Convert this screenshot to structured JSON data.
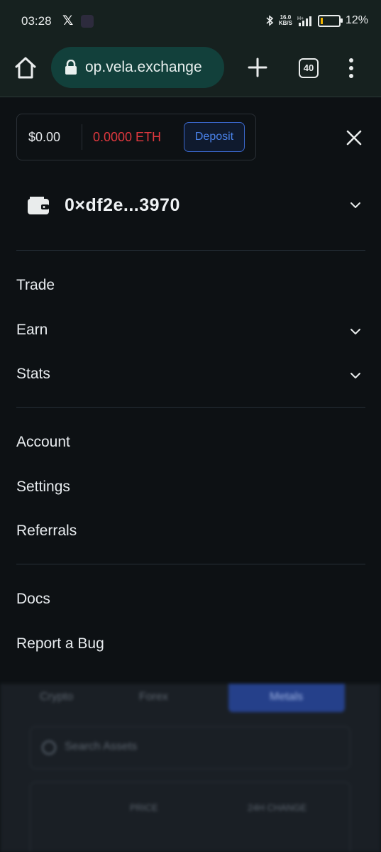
{
  "status_bar": {
    "time": "03:28",
    "x_app": "𝕏",
    "net_speed_value": "16.0",
    "net_speed_unit": "KB/S",
    "network": "H+",
    "battery_percent": "12%",
    "battery_level": 0.12,
    "battery_color": "#f0b400"
  },
  "browser": {
    "url_visible": "op.vela.exchange",
    "tab_count": "40"
  },
  "menu": {
    "balance_usd": "$0.00",
    "balance_eth": "0.0000 ETH",
    "deposit_label": "Deposit",
    "wallet_address": "0×df2e...3970",
    "items_group1": [
      {
        "label": "Trade",
        "has_chevron": false
      },
      {
        "label": "Earn",
        "has_chevron": true
      },
      {
        "label": "Stats",
        "has_chevron": true
      }
    ],
    "items_group2": [
      {
        "label": "Account"
      },
      {
        "label": "Settings"
      },
      {
        "label": "Referrals"
      }
    ],
    "items_group3": [
      {
        "label": "Docs"
      },
      {
        "label": "Report a Bug"
      }
    ]
  },
  "background_page": {
    "tabs": [
      "Crypto",
      "Forex",
      "Metals"
    ],
    "search_placeholder": "Search Assets",
    "columns": [
      "PRICE",
      "24H CHANGE"
    ]
  },
  "colors": {
    "accent_blue": "#3a66c9",
    "eth_red": "#e0383e",
    "toolbar_bg": "#16211f",
    "url_pill_bg": "#12403b",
    "panel_bg": "#0d1114"
  }
}
